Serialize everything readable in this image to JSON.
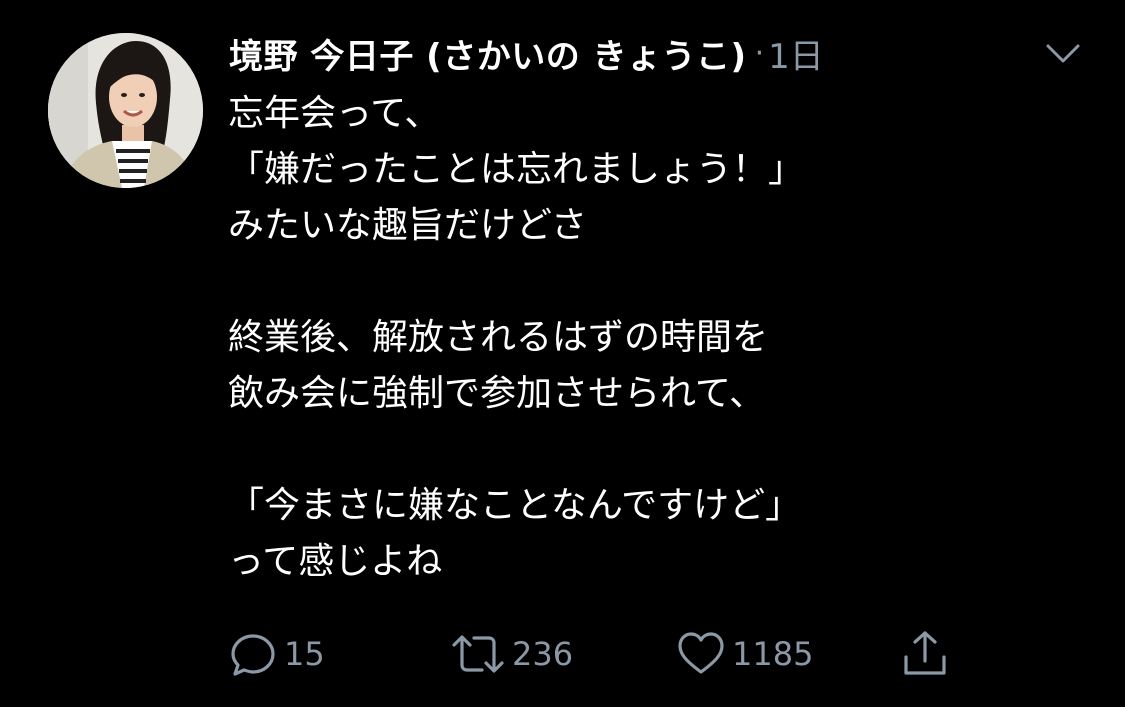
{
  "tweet": {
    "author": {
      "display_name": "境野 今日子 (さかいの きょうこ)",
      "avatar_icon": "profile-photo-avatar"
    },
    "separator": "·",
    "timestamp": "1日",
    "menu_icon": "chevron-down-icon",
    "lines": [
      "忘年会って、",
      "「嫌だったことは忘れましょう！」",
      "みたいな趣旨だけどさ",
      "",
      "終業後、解放されるはずの時間を",
      "飲み会に強制で参加させられて、",
      "",
      "「今まさに嫌なことなんですけど」",
      "って感じよね"
    ],
    "actions": {
      "reply": {
        "icon": "reply-icon",
        "count": "15"
      },
      "retweet": {
        "icon": "retweet-icon",
        "count": "236"
      },
      "like": {
        "icon": "heart-icon",
        "count": "1185"
      },
      "share": {
        "icon": "share-icon"
      }
    }
  },
  "colors": {
    "background": "#000000",
    "text": "#ffffff",
    "secondary": "#8b98a5"
  }
}
